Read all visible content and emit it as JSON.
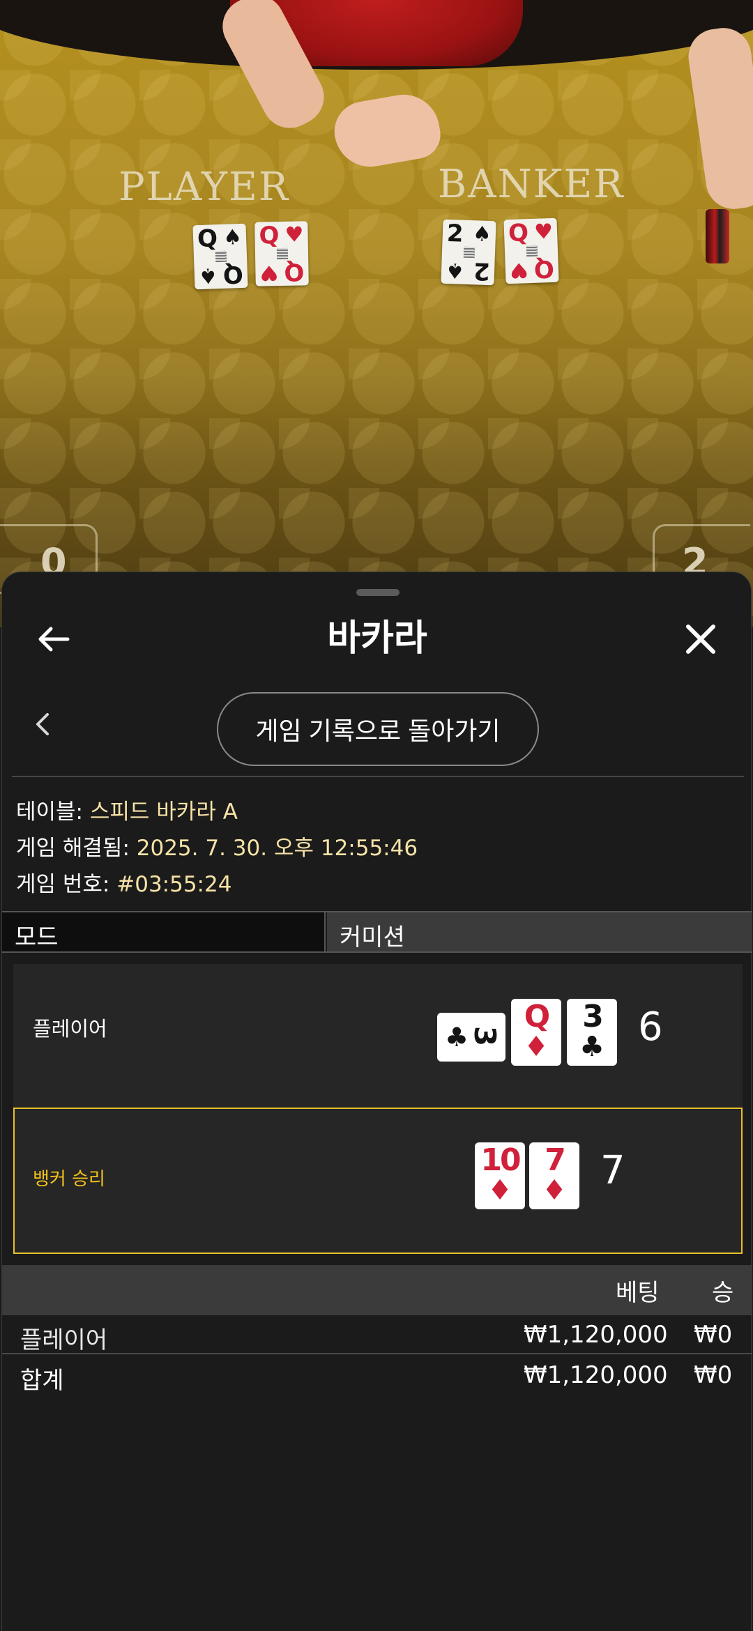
{
  "video": {
    "player_label": "PLAYER",
    "banker_label": "BANKER",
    "player_cards": [
      {
        "rank": "Q",
        "suit": "♠",
        "color": "black"
      },
      {
        "rank": "Q",
        "suit": "♥",
        "color": "red"
      }
    ],
    "banker_cards": [
      {
        "rank": "2",
        "suit": "♠",
        "color": "black"
      },
      {
        "rank": "Q",
        "suit": "♥",
        "color": "red"
      }
    ],
    "left_score": "0",
    "right_score": "2"
  },
  "header": {
    "title": "바카라",
    "back_icon": "arrow-left-icon",
    "close_icon": "close-icon"
  },
  "nav": {
    "chevron_icon": "chevron-left-icon",
    "back_to_history": "게임 기록으로 돌아가기"
  },
  "info": {
    "table_label": "테이블:",
    "table_value": "스피드 바카라 A",
    "resolved_label": "게임 해결됨:",
    "resolved_value": "2025. 7. 30. 오후 12:55:46",
    "game_no_label": "게임 번호:",
    "game_no_value": "#03:55:24"
  },
  "mode": {
    "mode_label": "모드",
    "commission_label": "커미션"
  },
  "result": {
    "player_label": "플레이어",
    "player_cards": [
      {
        "rank": "3",
        "suit": "♣",
        "color": "black",
        "sideways": true
      },
      {
        "rank": "Q",
        "suit": "♦",
        "color": "red"
      },
      {
        "rank": "3",
        "suit": "♣",
        "color": "black"
      }
    ],
    "player_score": "6",
    "banker_label": "뱅커 승리",
    "banker_cards": [
      {
        "rank": "10",
        "suit": "♦",
        "color": "red"
      },
      {
        "rank": "7",
        "suit": "♦",
        "color": "red"
      }
    ],
    "banker_score": "7",
    "win_color": "#f2c21b"
  },
  "bets": {
    "col_bet": "베팅",
    "col_win": "승",
    "rows": [
      {
        "name": "플레이어",
        "bet": "₩1,120,000",
        "win": "₩0"
      }
    ],
    "total": {
      "name": "합계",
      "bet": "₩1,120,000",
      "win": "₩0"
    }
  }
}
